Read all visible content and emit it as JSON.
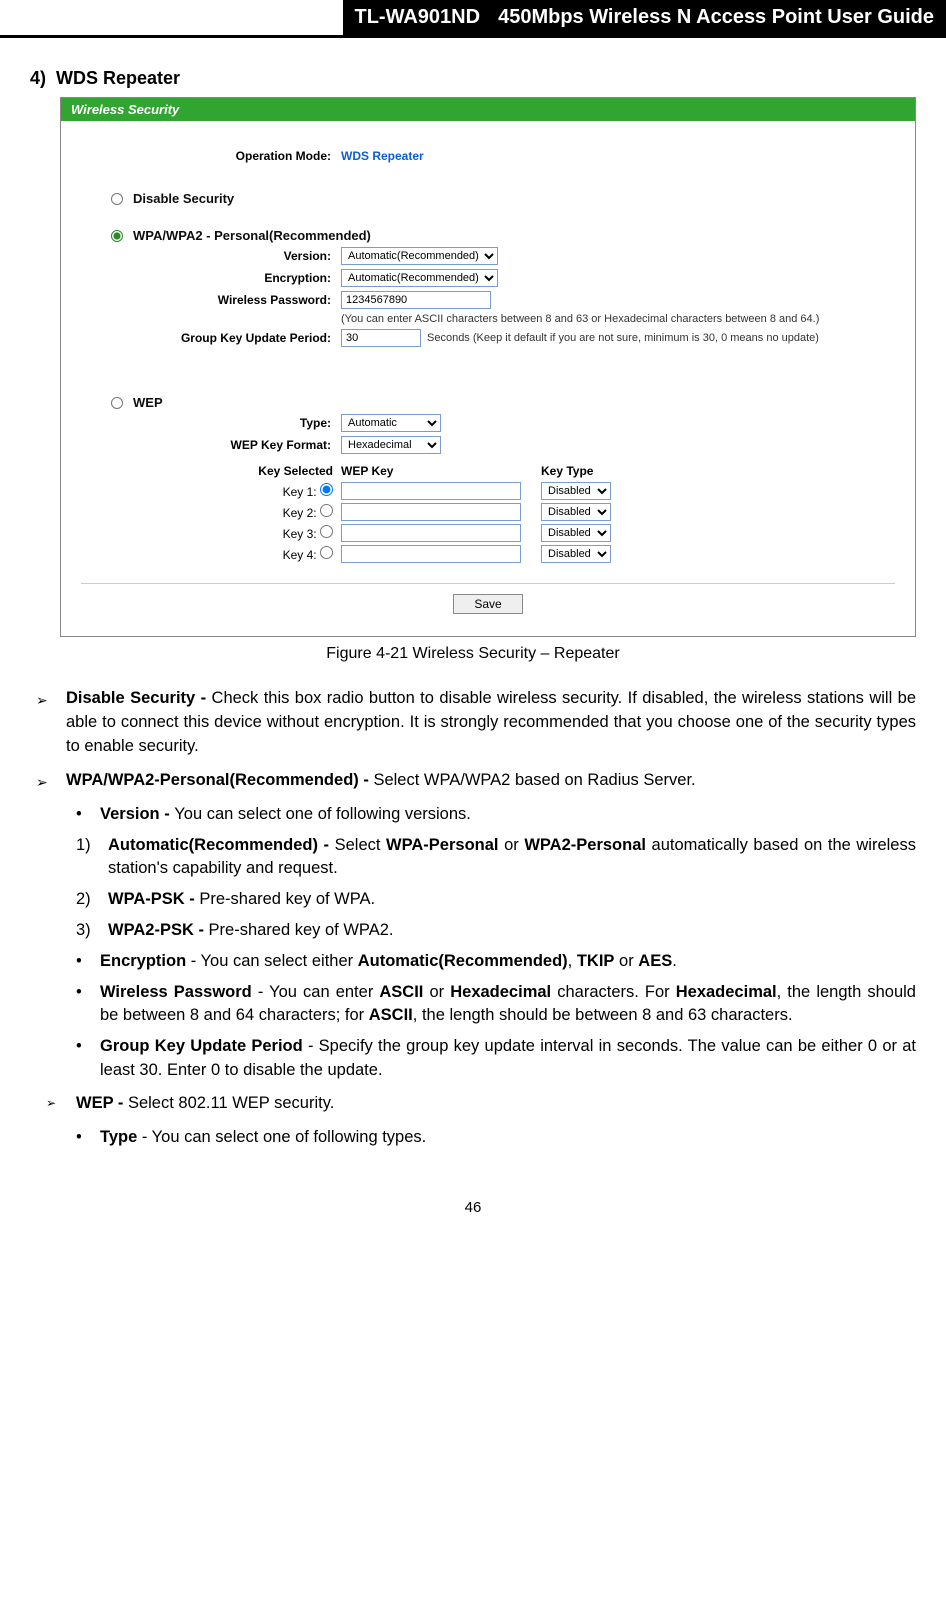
{
  "header": {
    "model": "TL-WA901ND",
    "guide": "450Mbps Wireless N Access Point User Guide"
  },
  "section": {
    "number": "4)",
    "title": "WDS Repeater"
  },
  "screenshot": {
    "panel_title": "Wireless Security",
    "op_mode_label": "Operation Mode:",
    "op_mode_value": "WDS Repeater",
    "disable_label": "Disable Security",
    "wpa_label": "WPA/WPA2 - Personal(Recommended)",
    "version_label": "Version:",
    "version_value": "Automatic(Recommended)",
    "encryption_label": "Encryption:",
    "encryption_value": "Automatic(Recommended)",
    "password_label": "Wireless Password:",
    "password_value": "1234567890",
    "password_hint": "(You can enter ASCII characters between 8 and 63 or Hexadecimal characters between 8 and 64.)",
    "group_key_label": "Group Key Update Period:",
    "group_key_value": "30",
    "group_key_hint": "Seconds (Keep it default if you are not sure, minimum is 30, 0 means no update)",
    "wep_label": "WEP",
    "type_label": "Type:",
    "type_value": "Automatic",
    "format_label": "WEP Key Format:",
    "format_value": "Hexadecimal",
    "key_selected_head": "Key Selected",
    "wep_key_head": "WEP Key",
    "key_type_head": "Key Type",
    "keys": [
      {
        "label": "Key 1:",
        "type": "Disabled"
      },
      {
        "label": "Key 2:",
        "type": "Disabled"
      },
      {
        "label": "Key 3:",
        "type": "Disabled"
      },
      {
        "label": "Key 4:",
        "type": "Disabled"
      }
    ],
    "save": "Save"
  },
  "caption": "Figure 4-21 Wireless Security – Repeater",
  "body": {
    "disable": {
      "head": "Disable Security - ",
      "text": "Check this box radio button to disable wireless security. If disabled, the wireless stations will be able to connect this device without encryption. It is strongly recommended that you choose one of the security types to enable security."
    },
    "wpa": {
      "head": "WPA/WPA2-Personal(Recommended) - ",
      "text": "Select WPA/WPA2 based on Radius Server."
    },
    "version": {
      "head": "Version - ",
      "text": "You can select one of following versions."
    },
    "v1": {
      "head": "Automatic(Recommended) - ",
      "mid1": "Select ",
      "b1": "WPA-Personal",
      "mid2": " or ",
      "b2": "WPA2-Personal",
      "tail": " automatically based on the wireless station's capability and request."
    },
    "v2": {
      "head": "WPA-PSK - ",
      "text": "Pre-shared key of WPA."
    },
    "v3": {
      "head": "WPA2-PSK - ",
      "text": "Pre-shared key of WPA2."
    },
    "encryption": {
      "head": "Encryption",
      "mid1": " - You can select either ",
      "b1": "Automatic(Recommended)",
      "mid2": ", ",
      "b2": "TKIP",
      "mid3": " or ",
      "b3": "AES",
      "tail": "."
    },
    "wpass": {
      "head": "Wireless Password",
      "mid1": " - You can enter ",
      "b1": "ASCII",
      "mid2": " or ",
      "b2": "Hexadecimal",
      "mid3": " characters. For ",
      "b3": "Hexadecimal",
      "mid4": ", the length should be between 8 and 64 characters; for ",
      "b4": "ASCII",
      "tail": ", the length should be between 8 and 63 characters."
    },
    "gkey": {
      "head": "Group Key Update Period",
      "text": " - Specify the group key update interval in seconds. The value can be either 0 or at least 30. Enter 0 to disable the update."
    },
    "wep": {
      "head": "WEP - ",
      "text": "Select 802.11 WEP security."
    },
    "weptype": {
      "head": "Type",
      "text": " - You can select one of following types."
    }
  },
  "page_number": "46"
}
